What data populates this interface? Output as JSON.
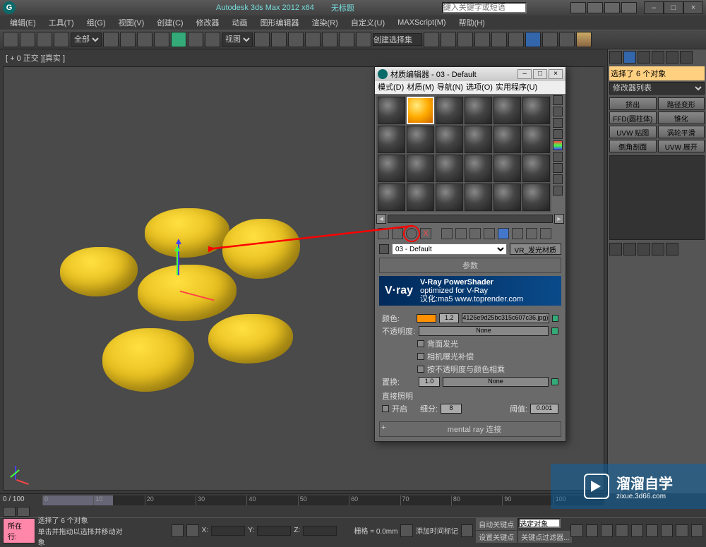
{
  "app": {
    "title": "Autodesk 3ds Max  2012  x64",
    "doc": "无标题",
    "search_placeholder": "键入关键字或短语"
  },
  "menu": {
    "edit": "编辑(E)",
    "tools": "工具(T)",
    "group": "组(G)",
    "views": "视图(V)",
    "create": "创建(C)",
    "modifiers": "修改器",
    "animation": "动画",
    "graph": "图形编辑器",
    "rendering": "渲染(R)",
    "customize": "自定义(U)",
    "maxscript": "MAXScript(M)",
    "help": "帮助(H)"
  },
  "toolbar": {
    "selection_dropdown": "全部",
    "view_dropdown": "视图",
    "selset_input": "创建选择集"
  },
  "viewport": {
    "label": "[ + 0 正交 ][真实 ]"
  },
  "cmd_panel": {
    "status": "选择了 6 个对象",
    "mod_list": "修改器列表",
    "buttons": {
      "extrude": "挤出",
      "path_deform": "路径变形",
      "ffd_cyl": "FFD(圆柱体)",
      "taper": "锥化",
      "uvw_map": "UVW 贴图",
      "turbosmooth": "涡轮平滑",
      "chamfer": "倒角剖面",
      "uvw_unwrap": "UVW 展开"
    }
  },
  "material_editor": {
    "title": "材质编辑器 - 03 - Default",
    "menu": {
      "mode": "模式(D)",
      "material": "材质(M)",
      "nav": "导航(N)",
      "options": "选项(O)",
      "util": "实用程序(U)"
    },
    "selected_slot": 1,
    "material_name": "03 - Default",
    "material_type": "VR_发光材质",
    "rollout_params": "参数",
    "vray": {
      "logo": "V·ray",
      "title": "V-Ray PowerShader",
      "sub1": "optimized for V-Ray",
      "sub2": "汉化:ma5  www.toprender.com"
    },
    "params": {
      "color_label": "颜色:",
      "color_mult": "1.2",
      "color_map": "4126e9d25bc315c607c36.jpg)",
      "opacity_label": "不透明度:",
      "opacity_map": "None",
      "back_emit": "背面发光",
      "cam_exposure": "相机曝光补偿",
      "mult_opacity_color": "按不透明度与颜色相乘",
      "displace_label": "置换:",
      "displace_mult": "1.0",
      "displace_map": "None",
      "direct_illum": "直接照明",
      "on_label": "开启",
      "subdiv_label": "细分:",
      "subdiv_val": "8",
      "cutoff_label": "阈值:",
      "cutoff_val": "0.001"
    },
    "mentalray_rollout": "mental ray 连接"
  },
  "timeline": {
    "range": "0 / 100"
  },
  "status": {
    "btn1": "所在行:",
    "line1": "选择了 6 个对象",
    "line2": "单击并拖动以选择并移动对象",
    "tag_add": "添加时间标记",
    "x": "X:",
    "y": "Y:",
    "z": "Z:",
    "grid": "栅格 = 0.0mm",
    "autokey": "自动关键点",
    "selset": "选定对象",
    "setkey": "设置关键点",
    "keyfilter": "关键点过滤器..."
  },
  "watermark": {
    "main": "溜溜自学",
    "sub": "zixue.3d66.com"
  }
}
